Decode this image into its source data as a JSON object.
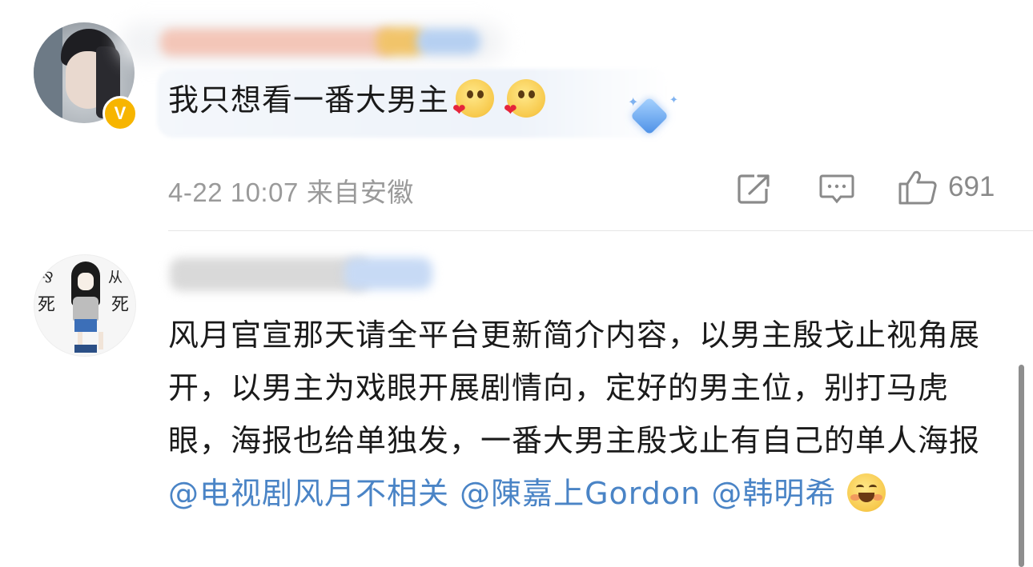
{
  "comments": [
    {
      "verified_badge": "V",
      "text": "我只想看一番大男主",
      "emojis": [
        "shy-heart-emoji",
        "shy-heart-emoji"
      ],
      "date": "4-22 10:07",
      "location": "来自安徽",
      "likes": "691",
      "icons": {
        "share": "share-icon",
        "comment": "comment-icon",
        "like": "thumbs-up-icon"
      }
    },
    {
      "text_plain": "风月官宣那天请全平台更新简介内容，以男主殷戈止视角展开，以男主为戏眼开展剧情向，定好的男主位，别打马虎眼，海报也给单独发，一番大男主殷戈止有自己的单人海报",
      "mention1": "@电视剧风月不相关",
      "mention2": "@陳嘉上Gordon",
      "mention3": "@韩明希",
      "emoji": "grin-emoji",
      "avatar_glyphs": [
        "死",
        "死"
      ]
    }
  ],
  "colors": {
    "text": "#1a1a1a",
    "meta": "#9a9a9a",
    "mention": "#4a84c6",
    "verified": "#f7b500"
  }
}
